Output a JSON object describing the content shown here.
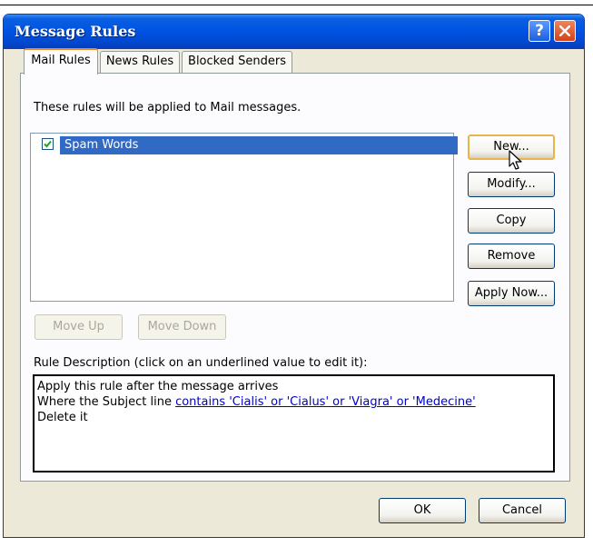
{
  "window": {
    "title": "Message Rules"
  },
  "titlebar": {
    "help_glyph": "?"
  },
  "tabs": [
    {
      "label": "Mail Rules",
      "active": true
    },
    {
      "label": "News Rules",
      "active": false
    },
    {
      "label": "Blocked Senders",
      "active": false
    }
  ],
  "main": {
    "intro": "These rules will be applied to Mail messages.",
    "rules": [
      {
        "name": "Spam Words",
        "checked": true,
        "selected": true
      }
    ]
  },
  "buttons": {
    "new": "New...",
    "modify": "Modify...",
    "copy": "Copy",
    "remove": "Remove",
    "apply_now": "Apply Now...",
    "move_up": "Move Up",
    "move_down": "Move Down",
    "ok": "OK",
    "cancel": "Cancel"
  },
  "description": {
    "label": "Rule Description (click on an underlined value to edit it):",
    "line1": "Apply this rule after the message arrives",
    "line2_prefix": "Where the Subject line ",
    "line2_link": "contains 'Cialis' or 'Cialus' or 'Viagra' or 'Medecine'",
    "line3": "Delete it"
  },
  "colors": {
    "titlebar": "#0054e3",
    "selection": "#316ac5",
    "dialog_bg": "#ece9d8",
    "link": "#0000cc",
    "default_button_border": "#e8b54a"
  },
  "icons": {
    "help": "help-icon",
    "close": "close-icon",
    "check": "checkmark-icon",
    "cursor": "mouse-pointer-icon"
  }
}
